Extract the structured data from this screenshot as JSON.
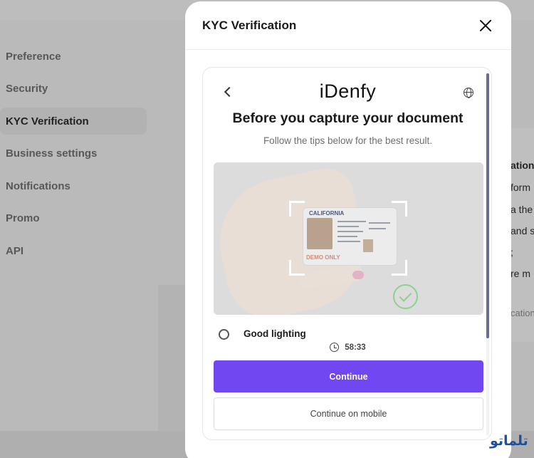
{
  "sidebar": {
    "items": [
      {
        "label": "Preference",
        "active": false
      },
      {
        "label": "Security",
        "active": false
      },
      {
        "label": "KYC Verification",
        "active": true
      },
      {
        "label": "Business settings",
        "active": false
      },
      {
        "label": "Notifications",
        "active": false
      },
      {
        "label": "Promo",
        "active": false
      },
      {
        "label": "API",
        "active": false
      }
    ]
  },
  "background_right": {
    "lines": [
      "ation",
      "form",
      "a the",
      "and s",
      ";",
      "re m",
      "cation"
    ]
  },
  "modal": {
    "title": "KYC Verification",
    "close_icon": "close-icon"
  },
  "idenfy": {
    "brand": "iDenfy",
    "heading": "Before you capture your document",
    "subheading": "Follow the tips below for the best result.",
    "id_card": {
      "state": "CALIFORNIA",
      "demo_label": "DEMO ONLY"
    },
    "tip": "Good lighting",
    "timer": "58:33",
    "continue_label": "Continue",
    "continue_mobile_label": "Continue on mobile",
    "accent_color": "#7047f0"
  },
  "watermark": "تلماتو"
}
